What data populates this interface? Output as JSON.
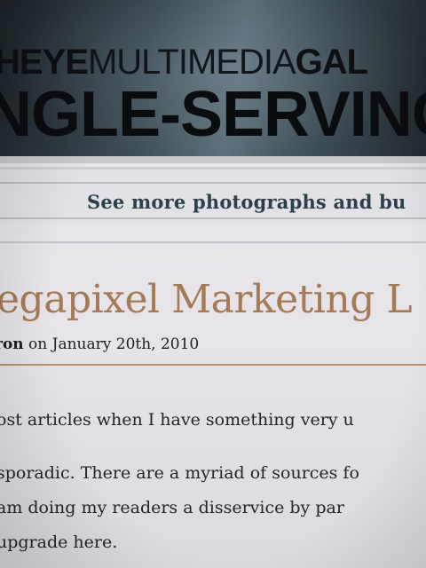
{
  "banner": {
    "supertitle_bold_1": "HEYE",
    "supertitle_light": "MULTIMEDIA",
    "supertitle_bold_2": "GAL",
    "title": "NGLE-SERVINC"
  },
  "nav": {
    "link_text": "See more photographs and bu"
  },
  "post": {
    "title": "egapixel Marketing L",
    "byline_author": "ron",
    "byline_rest": " on January 20th, 2010",
    "paragraph_lines": [
      "ost articles when I have something very u",
      " sporadic. There are a myriad of sources fo",
      " am doing my readers a disservice by par",
      "upgrade here."
    ]
  },
  "colors": {
    "title_accent": "#a57a56",
    "nav_text": "#2f3f4a",
    "banner_dark": "#1e262b"
  }
}
